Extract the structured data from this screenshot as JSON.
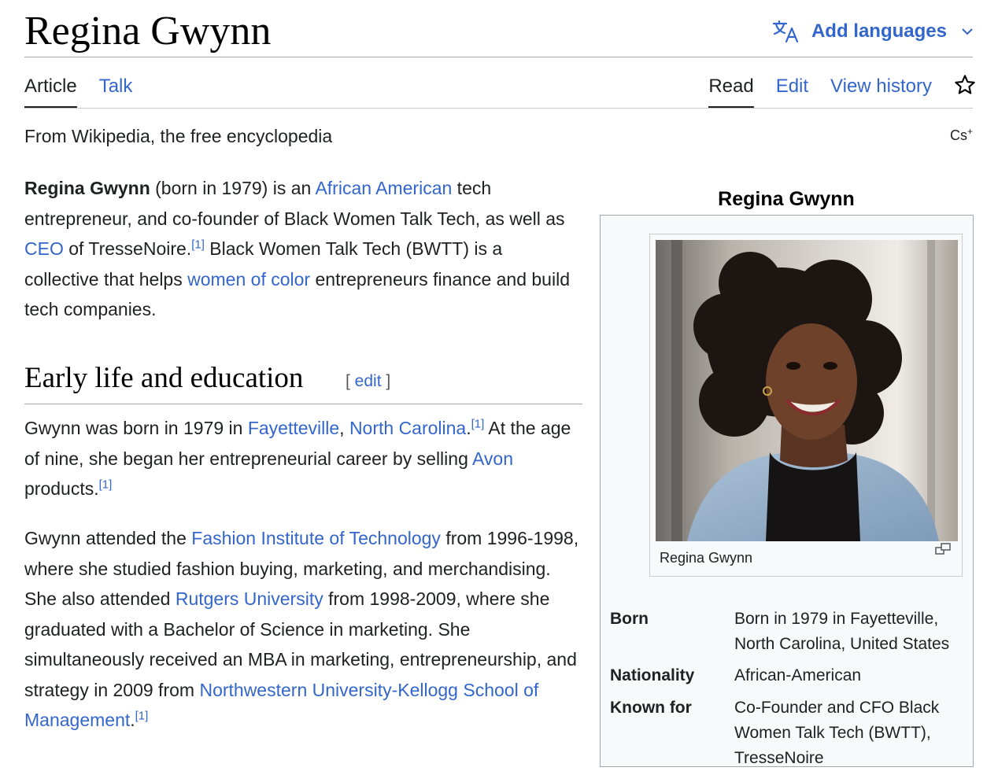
{
  "page": {
    "title": "Regina Gwynn",
    "add_languages": "Add languages",
    "tagline": "From Wikipedia, the free encyclopedia",
    "cs_plus": "Cs",
    "cs_plus_sup": "+"
  },
  "tabs": {
    "article": "Article",
    "talk": "Talk",
    "read": "Read",
    "edit": "Edit",
    "view_history": "View history"
  },
  "intro": {
    "subject": "Regina Gwynn",
    "t1": " (born in 1979) is an ",
    "link1": "African American",
    "t2": " tech entrepreneur, and co-founder of Black Women Talk Tech, as well as ",
    "link2": "CEO",
    "t3": " of TresseNoire.",
    "ref1": "[1]",
    "t4": " Black Women Talk Tech (BWTT) is a collective that helps ",
    "link3": "women of color",
    "t5": " entrepreneurs finance and build tech companies."
  },
  "early_life": {
    "heading": "Early life and education",
    "edit_open": "[ ",
    "edit_label": "edit",
    "edit_close": " ]",
    "p1": {
      "t1": "Gwynn was born in 1979 in ",
      "link1": "Fayetteville",
      "t2": ", ",
      "link2": "North Carolina",
      "t3": ".",
      "ref1": "[1]",
      "t4": " At the age of nine, she began her entrepreneurial career by selling ",
      "link3": "Avon",
      "t5": " products.",
      "ref2": "[1]"
    },
    "p2": {
      "t1": "Gwynn attended the ",
      "link1": "Fashion Institute of Technology",
      "t2": " from 1996-1998, where she studied fashion buying, marketing, and merchandising. She also attended ",
      "link2": "Rutgers University",
      "t3": " from 1998-2009, where she graduated with a Bachelor of Science in marketing. She simultaneously received an MBA in marketing, entrepreneurship, and strategy in 2009 from ",
      "link3": "Northwestern University-Kellogg School of Management",
      "t4": ".",
      "ref1": "[1]"
    }
  },
  "infobox": {
    "title": "Regina Gwynn",
    "caption": "Regina Gwynn",
    "rows": [
      {
        "label": "Born",
        "value": "Born in 1979 in Fayetteville, North Carolina, United States"
      },
      {
        "label": "Nationality",
        "value": "African-American"
      },
      {
        "label": "Known for",
        "value": "Co-Founder and CFO Black Women Talk Tech (BWTT), TresseNoire"
      }
    ]
  },
  "icons": {
    "translate": "translate-icon",
    "chevron": "chevron-down-icon",
    "watch": "star-icon",
    "enlarge": "enlarge-icon"
  },
  "colors": {
    "link": "#3366cc",
    "text": "#202122",
    "infobox_bg": "#f8f9fa",
    "border": "#a2a9b1"
  }
}
